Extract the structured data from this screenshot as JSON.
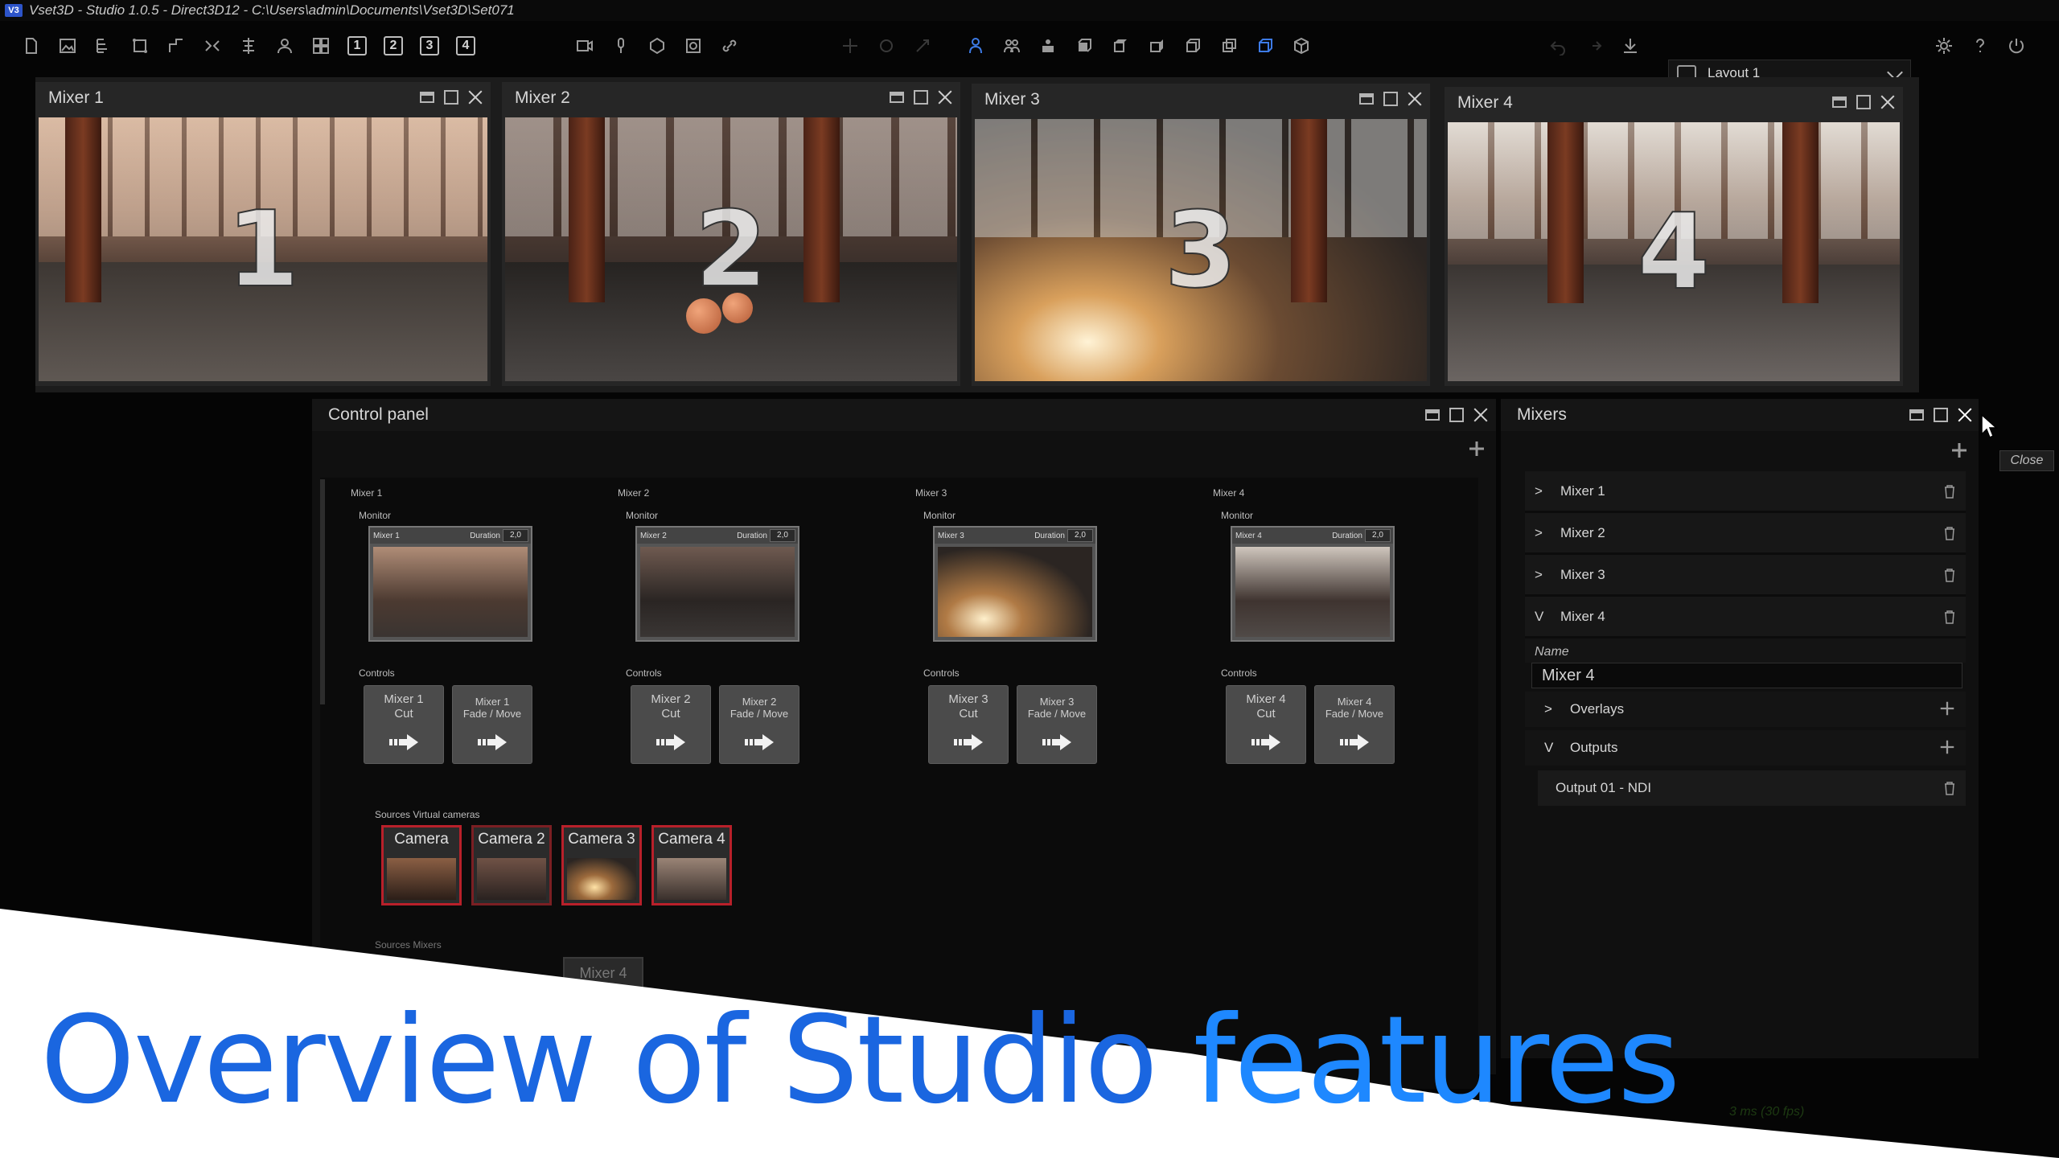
{
  "app": {
    "title": "Vset3D - Studio 1.0.5 - Direct3D12 - C:\\Users\\admin\\Documents\\Vset3D\\Set071",
    "logo_text": "V3"
  },
  "toolbar": {
    "layout_numbers": [
      "1",
      "2",
      "3",
      "4"
    ],
    "layout_select": "Layout 1",
    "accent_color": "#3d7be6"
  },
  "mixer_windows": [
    {
      "title": "Mixer 1",
      "overlay_number": "1"
    },
    {
      "title": "Mixer 2",
      "overlay_number": "2"
    },
    {
      "title": "Mixer 3",
      "overlay_number": "3"
    },
    {
      "title": "Mixer 4",
      "overlay_number": "4"
    }
  ],
  "control_panel": {
    "title": "Control panel",
    "monitor_label": "Monitor",
    "duration_label": "Duration",
    "controls_label": "Controls",
    "mixers": [
      {
        "name": "Mixer 1",
        "duration": "2,0",
        "cut": [
          "Mixer 1",
          "Cut"
        ],
        "fade": [
          "Mixer 1",
          "Fade / Move"
        ]
      },
      {
        "name": "Mixer 2",
        "duration": "2,0",
        "cut": [
          "Mixer 2",
          "Cut"
        ],
        "fade": [
          "Mixer 2",
          "Fade / Move"
        ]
      },
      {
        "name": "Mixer 3",
        "duration": "2,0",
        "cut": [
          "Mixer 3",
          "Cut"
        ],
        "fade": [
          "Mixer 3",
          "Fade / Move"
        ]
      },
      {
        "name": "Mixer 4",
        "duration": "2,0",
        "cut": [
          "Mixer 4",
          "Cut"
        ],
        "fade": [
          "Mixer 4",
          "Fade / Move"
        ]
      }
    ],
    "sources_virtual_label": "Sources Virtual cameras",
    "cameras": [
      "Camera",
      "Camera 2",
      "Camera 3",
      "Camera 4"
    ],
    "sources_mixers_label": "Sources Mixers",
    "mixer_source_partial": "Mixer 4"
  },
  "mixers_panel": {
    "title": "Mixers",
    "items": [
      "Mixer 1",
      "Mixer 2",
      "Mixer 3",
      "Mixer 4"
    ],
    "expanded": {
      "name_label": "Name",
      "name_value": "Mixer 4",
      "overlays_label": "Overlays",
      "outputs_label": "Outputs",
      "outputs": [
        "Output 01 - NDI"
      ]
    }
  },
  "tooltip": {
    "close": "Close"
  },
  "status": {
    "fps": "3 ms (30 fps)"
  },
  "banner": {
    "title_part1": "Overview of Studio ",
    "title_part2": "features",
    "color_dark": "#1a66e0",
    "color_light": "#1e88ff"
  }
}
